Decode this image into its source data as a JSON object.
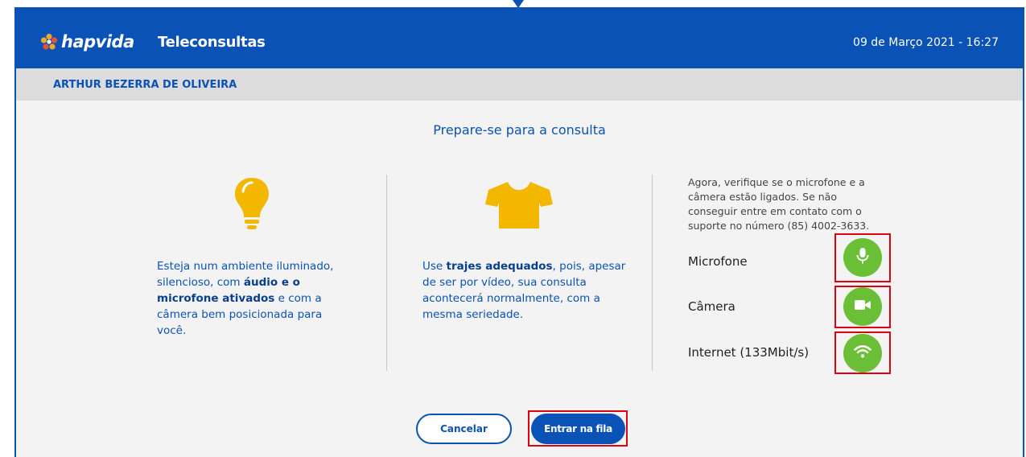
{
  "header": {
    "logo_text": "hapvida",
    "app_title": "Teleconsultas",
    "datetime": "09 de Março 2021 - 16:27"
  },
  "user": {
    "name": "ARTHUR BEZERRA DE OLIVEIRA"
  },
  "main": {
    "heading": "Prepare-se para a consulta",
    "tip1": {
      "icon": "lightbulb-icon",
      "part1": "Esteja num ambiente iluminado, silencioso, com ",
      "bold": "áudio e o microfone ativados",
      "part2": " e com a câmera bem posicionada para você."
    },
    "tip2": {
      "icon": "tshirt-icon",
      "part1": "Use ",
      "bold": "trajes adequados",
      "part2": ", pois, apesar de ser por vídeo, sua consulta acontecerá normalmente, com a mesma seriedade."
    },
    "check": {
      "info": "Agora, verifique se o microfone e a câmera estão ligados. Se não conseguir entre em contato com o suporte no número (85) 4002-3633.",
      "devices": [
        {
          "label": "Microfone",
          "icon": "microphone-icon"
        },
        {
          "label": "Câmera",
          "icon": "camera-icon"
        },
        {
          "label": "Internet (133Mbit/s)",
          "icon": "wifi-icon"
        }
      ]
    }
  },
  "actions": {
    "cancel_label": "Cancelar",
    "enter_label": "Entrar na fila"
  },
  "colors": {
    "brand_blue": "#0a52b5",
    "status_green": "#6bbf36",
    "accent_yellow": "#f3b700",
    "highlight_red": "#e0000f"
  }
}
